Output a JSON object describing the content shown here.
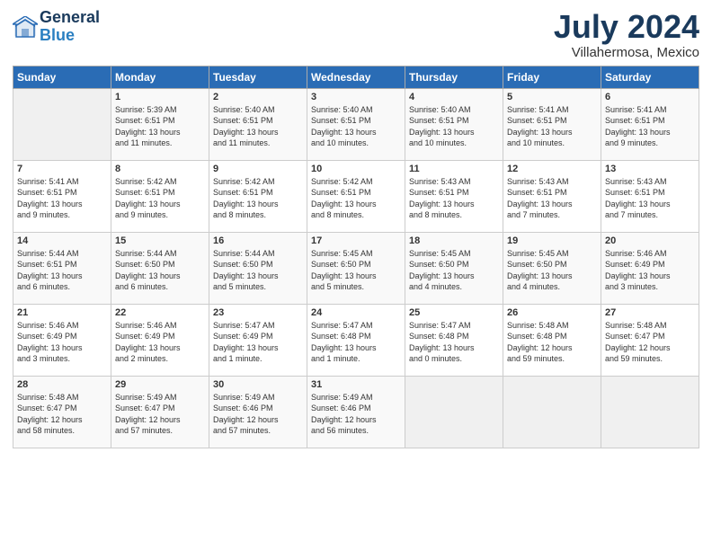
{
  "header": {
    "logo_line1": "General",
    "logo_line2": "Blue",
    "month": "July 2024",
    "location": "Villahermosa, Mexico"
  },
  "weekdays": [
    "Sunday",
    "Monday",
    "Tuesday",
    "Wednesday",
    "Thursday",
    "Friday",
    "Saturday"
  ],
  "weeks": [
    [
      {
        "day": "",
        "info": ""
      },
      {
        "day": "1",
        "info": "Sunrise: 5:39 AM\nSunset: 6:51 PM\nDaylight: 13 hours\nand 11 minutes."
      },
      {
        "day": "2",
        "info": "Sunrise: 5:40 AM\nSunset: 6:51 PM\nDaylight: 13 hours\nand 11 minutes."
      },
      {
        "day": "3",
        "info": "Sunrise: 5:40 AM\nSunset: 6:51 PM\nDaylight: 13 hours\nand 10 minutes."
      },
      {
        "day": "4",
        "info": "Sunrise: 5:40 AM\nSunset: 6:51 PM\nDaylight: 13 hours\nand 10 minutes."
      },
      {
        "day": "5",
        "info": "Sunrise: 5:41 AM\nSunset: 6:51 PM\nDaylight: 13 hours\nand 10 minutes."
      },
      {
        "day": "6",
        "info": "Sunrise: 5:41 AM\nSunset: 6:51 PM\nDaylight: 13 hours\nand 9 minutes."
      }
    ],
    [
      {
        "day": "7",
        "info": "Sunrise: 5:41 AM\nSunset: 6:51 PM\nDaylight: 13 hours\nand 9 minutes."
      },
      {
        "day": "8",
        "info": "Sunrise: 5:42 AM\nSunset: 6:51 PM\nDaylight: 13 hours\nand 9 minutes."
      },
      {
        "day": "9",
        "info": "Sunrise: 5:42 AM\nSunset: 6:51 PM\nDaylight: 13 hours\nand 8 minutes."
      },
      {
        "day": "10",
        "info": "Sunrise: 5:42 AM\nSunset: 6:51 PM\nDaylight: 13 hours\nand 8 minutes."
      },
      {
        "day": "11",
        "info": "Sunrise: 5:43 AM\nSunset: 6:51 PM\nDaylight: 13 hours\nand 8 minutes."
      },
      {
        "day": "12",
        "info": "Sunrise: 5:43 AM\nSunset: 6:51 PM\nDaylight: 13 hours\nand 7 minutes."
      },
      {
        "day": "13",
        "info": "Sunrise: 5:43 AM\nSunset: 6:51 PM\nDaylight: 13 hours\nand 7 minutes."
      }
    ],
    [
      {
        "day": "14",
        "info": "Sunrise: 5:44 AM\nSunset: 6:51 PM\nDaylight: 13 hours\nand 6 minutes."
      },
      {
        "day": "15",
        "info": "Sunrise: 5:44 AM\nSunset: 6:50 PM\nDaylight: 13 hours\nand 6 minutes."
      },
      {
        "day": "16",
        "info": "Sunrise: 5:44 AM\nSunset: 6:50 PM\nDaylight: 13 hours\nand 5 minutes."
      },
      {
        "day": "17",
        "info": "Sunrise: 5:45 AM\nSunset: 6:50 PM\nDaylight: 13 hours\nand 5 minutes."
      },
      {
        "day": "18",
        "info": "Sunrise: 5:45 AM\nSunset: 6:50 PM\nDaylight: 13 hours\nand 4 minutes."
      },
      {
        "day": "19",
        "info": "Sunrise: 5:45 AM\nSunset: 6:50 PM\nDaylight: 13 hours\nand 4 minutes."
      },
      {
        "day": "20",
        "info": "Sunrise: 5:46 AM\nSunset: 6:49 PM\nDaylight: 13 hours\nand 3 minutes."
      }
    ],
    [
      {
        "day": "21",
        "info": "Sunrise: 5:46 AM\nSunset: 6:49 PM\nDaylight: 13 hours\nand 3 minutes."
      },
      {
        "day": "22",
        "info": "Sunrise: 5:46 AM\nSunset: 6:49 PM\nDaylight: 13 hours\nand 2 minutes."
      },
      {
        "day": "23",
        "info": "Sunrise: 5:47 AM\nSunset: 6:49 PM\nDaylight: 13 hours\nand 1 minute."
      },
      {
        "day": "24",
        "info": "Sunrise: 5:47 AM\nSunset: 6:48 PM\nDaylight: 13 hours\nand 1 minute."
      },
      {
        "day": "25",
        "info": "Sunrise: 5:47 AM\nSunset: 6:48 PM\nDaylight: 13 hours\nand 0 minutes."
      },
      {
        "day": "26",
        "info": "Sunrise: 5:48 AM\nSunset: 6:48 PM\nDaylight: 12 hours\nand 59 minutes."
      },
      {
        "day": "27",
        "info": "Sunrise: 5:48 AM\nSunset: 6:47 PM\nDaylight: 12 hours\nand 59 minutes."
      }
    ],
    [
      {
        "day": "28",
        "info": "Sunrise: 5:48 AM\nSunset: 6:47 PM\nDaylight: 12 hours\nand 58 minutes."
      },
      {
        "day": "29",
        "info": "Sunrise: 5:49 AM\nSunset: 6:47 PM\nDaylight: 12 hours\nand 57 minutes."
      },
      {
        "day": "30",
        "info": "Sunrise: 5:49 AM\nSunset: 6:46 PM\nDaylight: 12 hours\nand 57 minutes."
      },
      {
        "day": "31",
        "info": "Sunrise: 5:49 AM\nSunset: 6:46 PM\nDaylight: 12 hours\nand 56 minutes."
      },
      {
        "day": "",
        "info": ""
      },
      {
        "day": "",
        "info": ""
      },
      {
        "day": "",
        "info": ""
      }
    ]
  ]
}
